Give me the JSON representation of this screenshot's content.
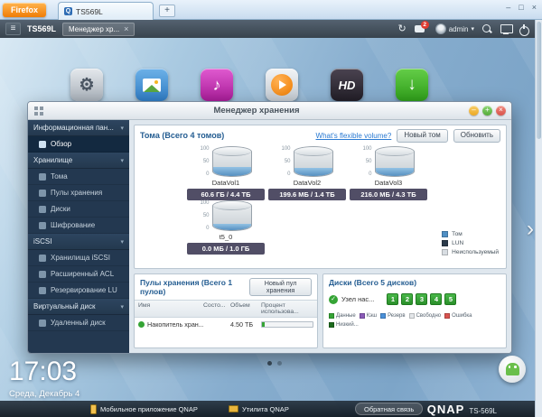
{
  "browser": {
    "app_button": "Firefox",
    "tab_title": "TS569L",
    "tab_favicon": "Q",
    "new_tab": "+",
    "controls": {
      "minimize": "–",
      "restore": "□",
      "close": "×"
    }
  },
  "topbar": {
    "menu_glyph": "≡",
    "device_name": "TS569L",
    "app_tab": "Менеджер хр...",
    "close_glyph": "×",
    "refresh_glyph": "↻",
    "notification_count": "2",
    "user": "admin",
    "caret": "▾"
  },
  "desktop": {
    "icons": [
      {
        "name": "control-panel",
        "glyph": "⚙"
      },
      {
        "name": "photo-station",
        "glyph": ""
      },
      {
        "name": "music-station",
        "glyph": "♪"
      },
      {
        "name": "video-station",
        "glyph": ""
      },
      {
        "name": "hd-station",
        "glyph": "HD"
      },
      {
        "name": "download-station",
        "glyph": "↓"
      }
    ],
    "next_arrow": "›"
  },
  "window": {
    "title": "Менеджер хранения",
    "controls": {
      "minimize": "–",
      "maximize": "+",
      "close": "×"
    },
    "sidebar": {
      "sections": [
        {
          "label": "Информационная пан...",
          "chevron": "▾",
          "items": [
            {
              "label": "Обзор"
            }
          ]
        },
        {
          "label": "Хранилище",
          "chevron": "▾",
          "items": [
            {
              "label": "Тома"
            },
            {
              "label": "Пулы хранения"
            },
            {
              "label": "Диски"
            },
            {
              "label": "Шифрование"
            }
          ]
        },
        {
          "label": "iSCSI",
          "chevron": "▾",
          "items": [
            {
              "label": "Хранилища iSCSI"
            },
            {
              "label": "Расширенный ACL"
            },
            {
              "label": "Резервирование LU"
            }
          ]
        },
        {
          "label": "Виртуальный диск",
          "chevron": "▾",
          "items": [
            {
              "label": "Удаленный диск"
            }
          ]
        }
      ]
    },
    "volumes_panel": {
      "title": "Тома (Всего 4 томов)",
      "link": "What's flexible volume?",
      "new_volume_button": "Новый том",
      "refresh_button": "Обновить",
      "gauge_ticks": [
        "100",
        "50",
        "0"
      ],
      "volumes": [
        {
          "name": "DataVol1",
          "usage": "60.6 ГБ / 4.4 ТБ",
          "fill": "30%"
        },
        {
          "name": "DataVol2",
          "usage": "199.6 МБ / 1.4 ТБ",
          "fill": "27%"
        },
        {
          "name": "DataVol3",
          "usage": "216.0 МБ / 4.3 ТБ",
          "fill": "27%"
        },
        {
          "name": "t5_0",
          "usage": "0.0 МБ / 1.0 ГБ",
          "fill": "22%"
        }
      ],
      "legend": [
        {
          "label": "Том",
          "color": "#4f8fc4"
        },
        {
          "label": "LUN",
          "color": "#2b3a4a"
        },
        {
          "label": "Неиспользуемый",
          "color": "#d8dde2"
        }
      ]
    },
    "pools_panel": {
      "title": "Пулы хранения (Всего 1 пулов)",
      "new_pool_button": "Новый пул хранения",
      "columns": [
        "Имя",
        "Состо...",
        "Объем",
        "Процент использова..."
      ],
      "rows": [
        {
          "name": "Накопитель хран...",
          "status_color": "#35a435",
          "capacity": "4.50 ТБ",
          "used_pct": "6%"
        }
      ]
    },
    "disks_panel": {
      "title": "Диски (Всего 5 дисков)",
      "host_label": "Узел нас...",
      "check_glyph": "✓",
      "slots": [
        "1",
        "2",
        "3",
        "4",
        "5"
      ],
      "legend": [
        {
          "label": "Данные",
          "color": "#35a435"
        },
        {
          "label": "Кэш",
          "color": "#8a5bb8"
        },
        {
          "label": "Резерв",
          "color": "#4a90d9"
        },
        {
          "label": "Свободно",
          "color": "#e3e6e9"
        },
        {
          "label": "Ошибка",
          "color": "#d9534f"
        },
        {
          "label": "Низкий...",
          "color": "#1d6b1d"
        }
      ]
    }
  },
  "clock": {
    "time": "17:03",
    "date": "Среда, Декабрь 4"
  },
  "taskbar": {
    "items": [
      {
        "label": "Мобильное приложение QNAP"
      },
      {
        "label": "Утилита QNAP"
      },
      {
        "label": "Обратная связь"
      }
    ],
    "brand": "QNAP",
    "model": "TS-569L"
  }
}
